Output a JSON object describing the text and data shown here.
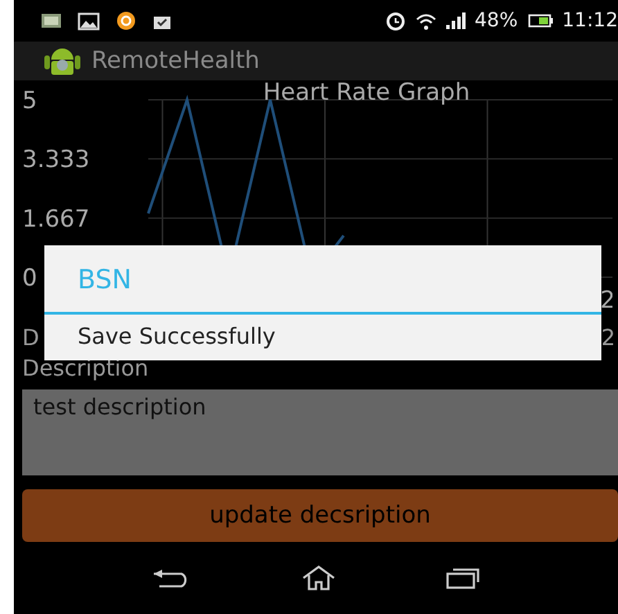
{
  "status_bar": {
    "battery_percent": "48%",
    "time": "11:12"
  },
  "action_bar": {
    "title": "RemoteHealth"
  },
  "chart": {
    "title": "Heart Rate Graph",
    "y_axis_labels": [
      "5",
      "3.333",
      "1.667",
      "0"
    ],
    "x_axis_label": "2"
  },
  "date_row": {
    "label": "D",
    "value": "2"
  },
  "description": {
    "label": "Description",
    "value": "test description"
  },
  "update_button": {
    "label": "update decsription"
  },
  "dialog": {
    "title": "BSN",
    "message": "Save Successfully"
  }
}
